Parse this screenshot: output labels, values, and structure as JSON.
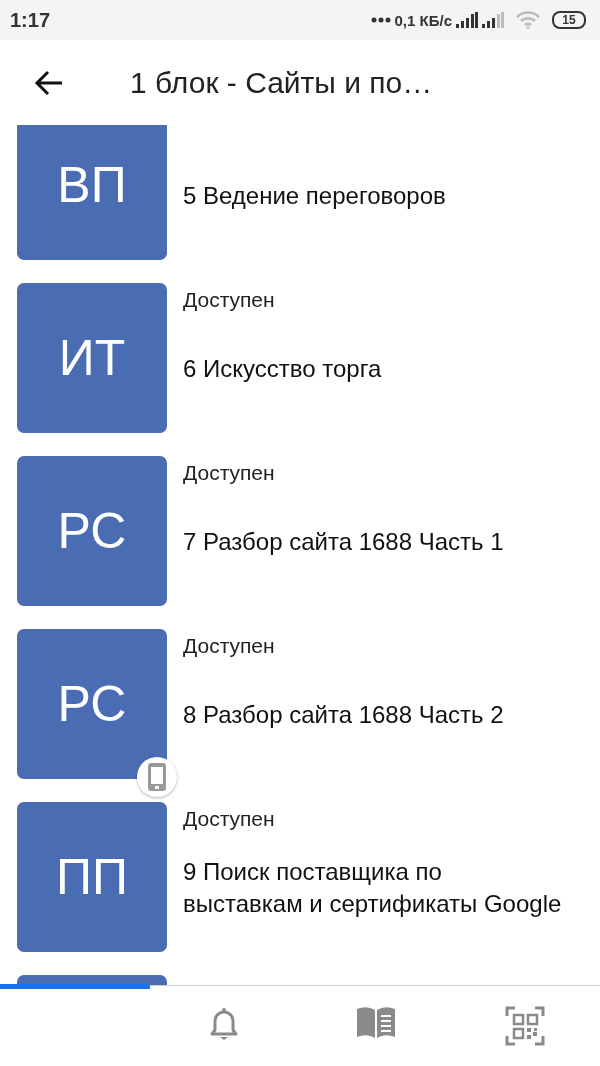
{
  "status_bar": {
    "time": "1:17",
    "speed": "0,1 КБ/с",
    "battery": "15"
  },
  "app_bar": {
    "title": "1 блок - Сайты и по…"
  },
  "lessons": [
    {
      "initials": "ВП",
      "title": "5 Ведение переговоров",
      "device_badge": false
    },
    {
      "initials": "ИТ",
      "status": "Доступен",
      "title": "6 Искусство торга",
      "device_badge": false
    },
    {
      "initials": "РС",
      "status": "Доступен",
      "title": "7 Разбор сайта 1688 Часть 1",
      "device_badge": false
    },
    {
      "initials": "РС",
      "status": "Доступен",
      "title": "8 Разбор сайта 1688 Часть 2",
      "device_badge": true
    },
    {
      "initials": "ПП",
      "status": "Доступен",
      "title": "9 Поиск поставщика по выставкам и сертификаты Google",
      "device_badge": false
    },
    {
      "device_badge": false
    }
  ],
  "progress": {
    "level": 0.25
  }
}
